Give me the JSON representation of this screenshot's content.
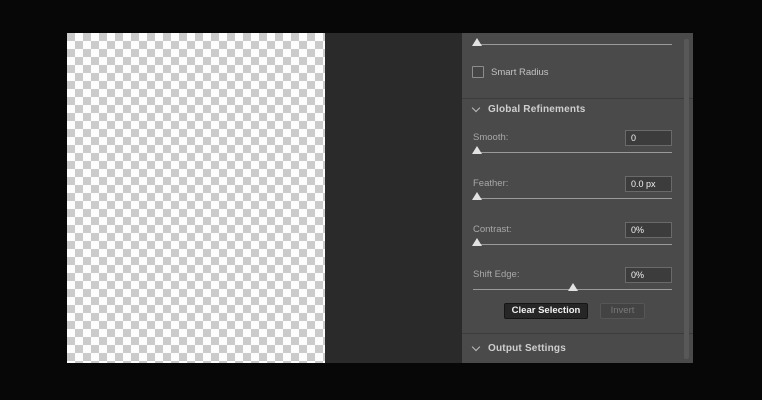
{
  "colors": {
    "background": "#070707",
    "pasteboard": "#2a2a2a",
    "panel_bg": "#4a4a4a",
    "checker_light": "#fdfdfd",
    "checker_dark": "#cbcbcb",
    "slider_track": "#9a9a9a",
    "slider_thumb": "#e2e2e2",
    "value_text": "#f0f0f0"
  },
  "panel": {
    "top_slider": {
      "slider_pct": 2
    },
    "smart_radius": {
      "label": "Smart Radius",
      "checked": false
    },
    "global_refinements": {
      "title": "Global Refinements",
      "collapsed": false,
      "controls": [
        {
          "label": "Smooth:",
          "value": "0",
          "slider_pct": 2
        },
        {
          "label": "Feather:",
          "value": "0.0 px",
          "slider_pct": 2
        },
        {
          "label": "Contrast:",
          "value": "0%",
          "slider_pct": 2
        },
        {
          "label": "Shift Edge:",
          "value": "0%",
          "slider_pct": 50
        }
      ],
      "clear_selection_label": "Clear Selection",
      "invert_label": "Invert",
      "invert_enabled": false
    },
    "output_settings": {
      "title": "Output Settings",
      "collapsed": false
    }
  }
}
